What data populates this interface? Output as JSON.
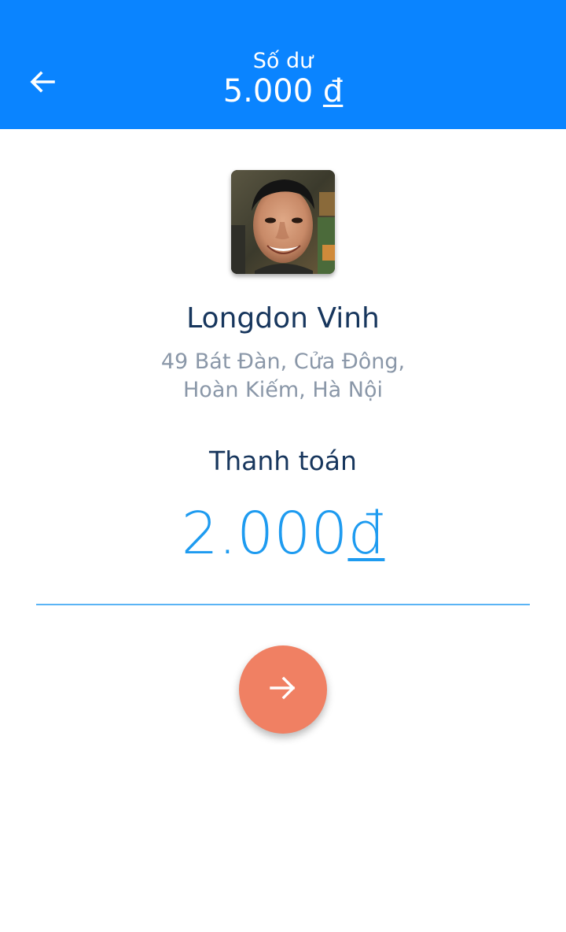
{
  "header": {
    "balance_label": "Số dư",
    "balance_amount": "5.000",
    "currency_symbol": "đ",
    "back_icon": "arrow-left-icon",
    "background_color": "#0a84ff"
  },
  "merchant": {
    "name": "Longdon Vinh",
    "address_line1": "49 Bát Đàn, Cửa Đông,",
    "address_line2": "Hoàn Kiếm, Hà Nội",
    "avatar": "avatar-photo"
  },
  "payment": {
    "label": "Thanh toán",
    "amount": "2.000",
    "currency_symbol": "đ",
    "amount_color": "#1e9bf0"
  },
  "submit": {
    "icon": "arrow-right-icon",
    "color": "#f08063"
  }
}
